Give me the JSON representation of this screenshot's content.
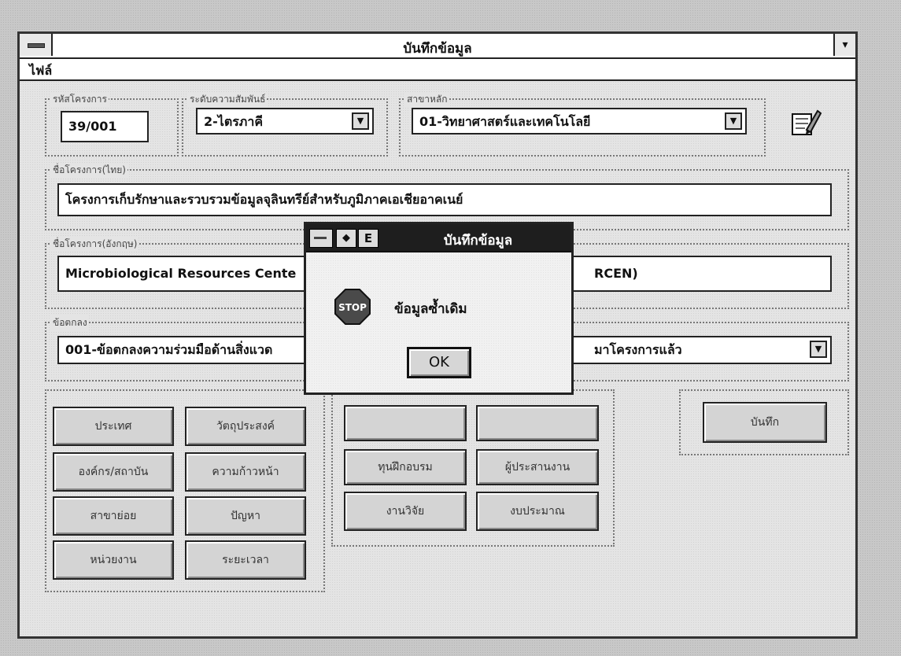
{
  "window": {
    "title": "บันทึกข้อมูล",
    "menu": [
      "ไฟล์"
    ],
    "maximize_glyph": "▾"
  },
  "form": {
    "project_code": {
      "label": "รหัสโครงการ",
      "value": "39/001"
    },
    "cooperation_level": {
      "label": "ระดับความสัมพันธ์",
      "value": "2-ไตรภาคี"
    },
    "main_field": {
      "label": "สาขาหลัก",
      "value": "01-วิทยาศาสตร์และเทคโนโลยี"
    },
    "project_name_th": {
      "label": "ชื่อโครงการ(ไทย)",
      "value": "โครงการเก็บรักษาและรวบรวมข้อมูลจุลินทรีย์สำหรับภูมิภาคเอเชียอาคเนย์"
    },
    "project_name_en": {
      "label": "ชื่อโครงการ(อังกฤษ)",
      "value": "Microbiological Resources Cente",
      "value_tail": "RCEN)"
    },
    "agreement": {
      "label": "ข้อตกลง",
      "value": "001-ข้อตกลงความร่วมมือด้านสิ่งแวด",
      "value_tail": "มาโครงการแล้ว"
    }
  },
  "buttons": {
    "col1": [
      "ประเทศ",
      "องค์กร/สถาบัน",
      "สาขาย่อย",
      "หน่วยงาน"
    ],
    "col2": [
      "วัตถุประสงค์",
      "ความก้าวหน้า",
      "ปัญหา",
      "ระยะเวลา"
    ],
    "col3": [
      "ทุนฝึกอบรม",
      "งานวิจัย"
    ],
    "col4": [
      "ผู้ประสานงาน",
      "งบประมาณ"
    ],
    "save": "บันทึก"
  },
  "dialog": {
    "title": "บันทึกข้อมูล",
    "icon": "stop-icon",
    "stop_text": "STOP",
    "message": "ข้อมูลซ้ำเดิม",
    "ok": "OK",
    "doc_icon_glyph": "E"
  },
  "colors": {
    "dialog_title_bg": "#1e1e1e",
    "window_bg": "#e4e4e4",
    "stop_red": "#5a5a5a"
  }
}
